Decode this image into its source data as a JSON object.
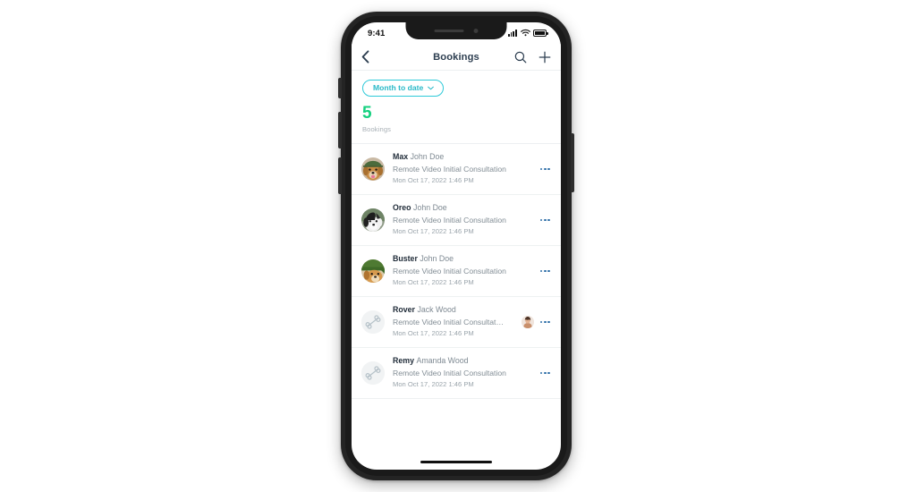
{
  "device": {
    "status_bar": {
      "time": "9:41",
      "signal_icon": "cellular-signal-icon",
      "wifi_icon": "wifi-icon",
      "battery_icon": "battery-full-icon"
    },
    "home_indicator": "home-indicator"
  },
  "nav": {
    "back_icon": "chevron-left-icon",
    "title": "Bookings",
    "search_icon": "search-icon",
    "add_icon": "plus-icon"
  },
  "summary": {
    "filter_label": "Month to date",
    "filter_chevron_icon": "chevron-down-icon",
    "stat_value": "5",
    "stat_label": "Bookings"
  },
  "bookings": [
    {
      "pet": "Max",
      "owner": "John Doe",
      "service": "Remote Video Initial Consultation",
      "datetime": "Mon Oct 17, 2022 1:46 PM",
      "avatar_icon": "dog-photo-avatar-golden",
      "has_staff_avatar": false,
      "menu_icon": "more-options-icon"
    },
    {
      "pet": "Oreo",
      "owner": "John Doe",
      "service": "Remote Video Initial Consultation",
      "datetime": "Mon Oct 17, 2022 1:46 PM",
      "avatar_icon": "dog-photo-avatar-blackwhite",
      "has_staff_avatar": false,
      "menu_icon": "more-options-icon"
    },
    {
      "pet": "Buster",
      "owner": "John Doe",
      "service": "Remote Video Initial Consultation",
      "datetime": "Mon Oct 17, 2022 1:46 PM",
      "avatar_icon": "dog-photo-avatar-grass",
      "has_staff_avatar": false,
      "menu_icon": "more-options-icon"
    },
    {
      "pet": "Rover",
      "owner": "Jack Wood",
      "service": "Remote Video Initial Consultat…",
      "datetime": "Mon Oct 17, 2022 1:46 PM",
      "avatar_icon": "bone-placeholder-icon",
      "has_staff_avatar": true,
      "staff_avatar_icon": "staff-person-avatar",
      "menu_icon": "more-options-icon"
    },
    {
      "pet": "Remy",
      "owner": "Amanda Wood",
      "service": "Remote Video Initial Consultation",
      "datetime": "Mon Oct 17, 2022 1:46 PM",
      "avatar_icon": "bone-placeholder-icon",
      "has_staff_avatar": false,
      "menu_icon": "more-options-icon"
    }
  ],
  "colors": {
    "accent_teal": "#2ec9d8",
    "stat_green": "#15d07f",
    "title_navy": "#2d3e50",
    "menu_blue": "#2f6fa8",
    "muted_gray": "#828d95"
  }
}
